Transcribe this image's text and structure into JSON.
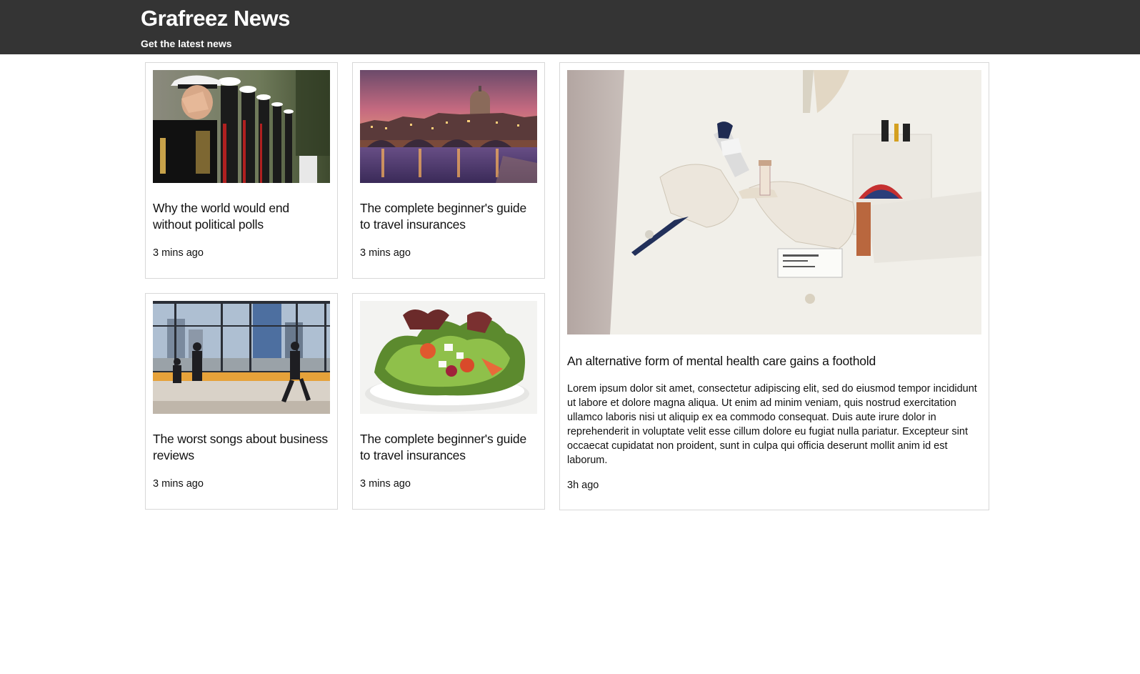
{
  "header": {
    "title": "Grafreez News",
    "tagline": "Get the latest news"
  },
  "colors": {
    "header_bg": "#343434",
    "header_text": "#ffffff",
    "card_border": "#d8d8d8"
  },
  "articles": [
    {
      "image": "marines-salute-photo",
      "headline": "Why the world would end without political polls",
      "time": "3 mins ago"
    },
    {
      "image": "rome-bridge-sunset-photo",
      "headline": "The complete beginner's guide to travel insurances",
      "time": "3 mins ago"
    },
    {
      "image": "office-window-people-photo",
      "headline": "The worst songs about business reviews",
      "time": "3 mins ago"
    },
    {
      "image": "salad-bowl-photo",
      "headline": "The complete beginner's guide to travel insurances",
      "time": "3 mins ago"
    }
  ],
  "featured": {
    "image": "lab-coat-pipette-photo",
    "headline": "An alternative form of mental health care gains a foothold",
    "summary": "Lorem ipsum dolor sit amet, consectetur adipiscing elit, sed do eiusmod tempor incididunt ut labore et dolore magna aliqua. Ut enim ad minim veniam, quis nostrud exercitation ullamco laboris nisi ut aliquip ex ea commodo consequat. Duis aute irure dolor in reprehenderit in voluptate velit esse cillum dolore eu fugiat nulla pariatur. Excepteur sint occaecat cupidatat non proident, sunt in culpa qui officia deserunt mollit anim id est laborum.",
    "time": "3h ago"
  }
}
